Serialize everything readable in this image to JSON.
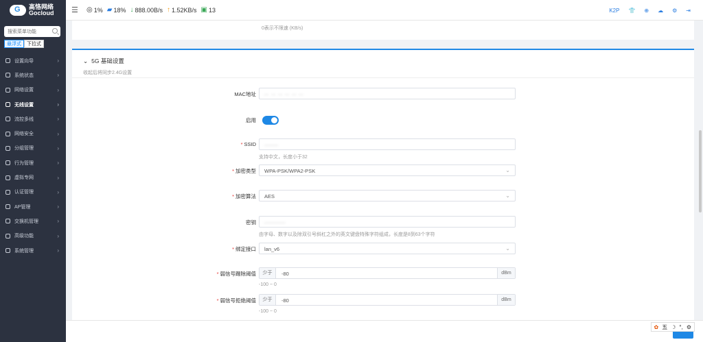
{
  "brand": {
    "name_cn": "高恪网络",
    "name_en": "Gocloud"
  },
  "sidebar": {
    "search_placeholder": "搜索菜单功能",
    "mode_options": [
      "悬浮式",
      "下拉式"
    ],
    "items": [
      {
        "label": "设置向导",
        "icon": "wizard-icon",
        "active": false
      },
      {
        "label": "系统状态",
        "icon": "status-icon",
        "active": false
      },
      {
        "label": "网络设置",
        "icon": "monitor-icon",
        "active": false
      },
      {
        "label": "无线设置",
        "icon": "wifi-icon",
        "active": true
      },
      {
        "label": "流控多线",
        "icon": "flow-icon",
        "active": false
      },
      {
        "label": "网络安全",
        "icon": "shield-icon",
        "active": false
      },
      {
        "label": "分组管理",
        "icon": "group-icon",
        "active": false
      },
      {
        "label": "行为管理",
        "icon": "behavior-icon",
        "active": false
      },
      {
        "label": "虚拟专网",
        "icon": "vpn-icon",
        "active": false
      },
      {
        "label": "认证管理",
        "icon": "auth-icon",
        "active": false
      },
      {
        "label": "AP管理",
        "icon": "ap-icon",
        "active": false
      },
      {
        "label": "交换机管理",
        "icon": "switch-icon",
        "active": false
      },
      {
        "label": "高级功能",
        "icon": "advanced-icon",
        "active": false
      },
      {
        "label": "系统管理",
        "icon": "gear-icon",
        "active": false
      }
    ]
  },
  "topbar": {
    "cpu": "1%",
    "mem": "18%",
    "download": "888.00B/s",
    "upload": "1.52KB/s",
    "clients": "13",
    "k2p": "K2P"
  },
  "top_card": {
    "hint": "0表示不限速 (KB/s)"
  },
  "section": {
    "title": "5G 基础设置",
    "subtitle": "收起后将同步2.4G设置"
  },
  "form": {
    "mac": {
      "label": "MAC地址",
      "value": "·· ·· ·· ·· ·· ··"
    },
    "enable": {
      "label": "启用",
      "on": true
    },
    "ssid": {
      "label": "SSID",
      "value": "······",
      "hint": "支持中文，长度小于32"
    },
    "encryption": {
      "label": "加密类型",
      "value": "WPA-PSK/WPA2-PSK"
    },
    "algorithm": {
      "label": "加密算法",
      "value": "AES"
    },
    "password": {
      "label": "密钥",
      "value": "·········",
      "hint": "由字母、数字以及除双引号斜杠之外的英文键盘特殊字符组成，长度是8到63个字符"
    },
    "interface": {
      "label": "绑定接口",
      "value": "lan_v6"
    },
    "kick_threshold": {
      "label": "弱信号踢除阈值",
      "prefix": "少于",
      "value": "-80",
      "suffix": "dBm",
      "hint": "-100 ~ 0"
    },
    "reject_threshold": {
      "label": "弱信号拒绝阈值",
      "prefix": "少于",
      "value": "-80",
      "suffix": "dBm",
      "hint": "-100 ~ 0"
    }
  },
  "ime": {
    "label": "五"
  },
  "colors": {
    "accent": "#1e88e5",
    "sidebar": "#2c3240",
    "required": "#e53935"
  }
}
